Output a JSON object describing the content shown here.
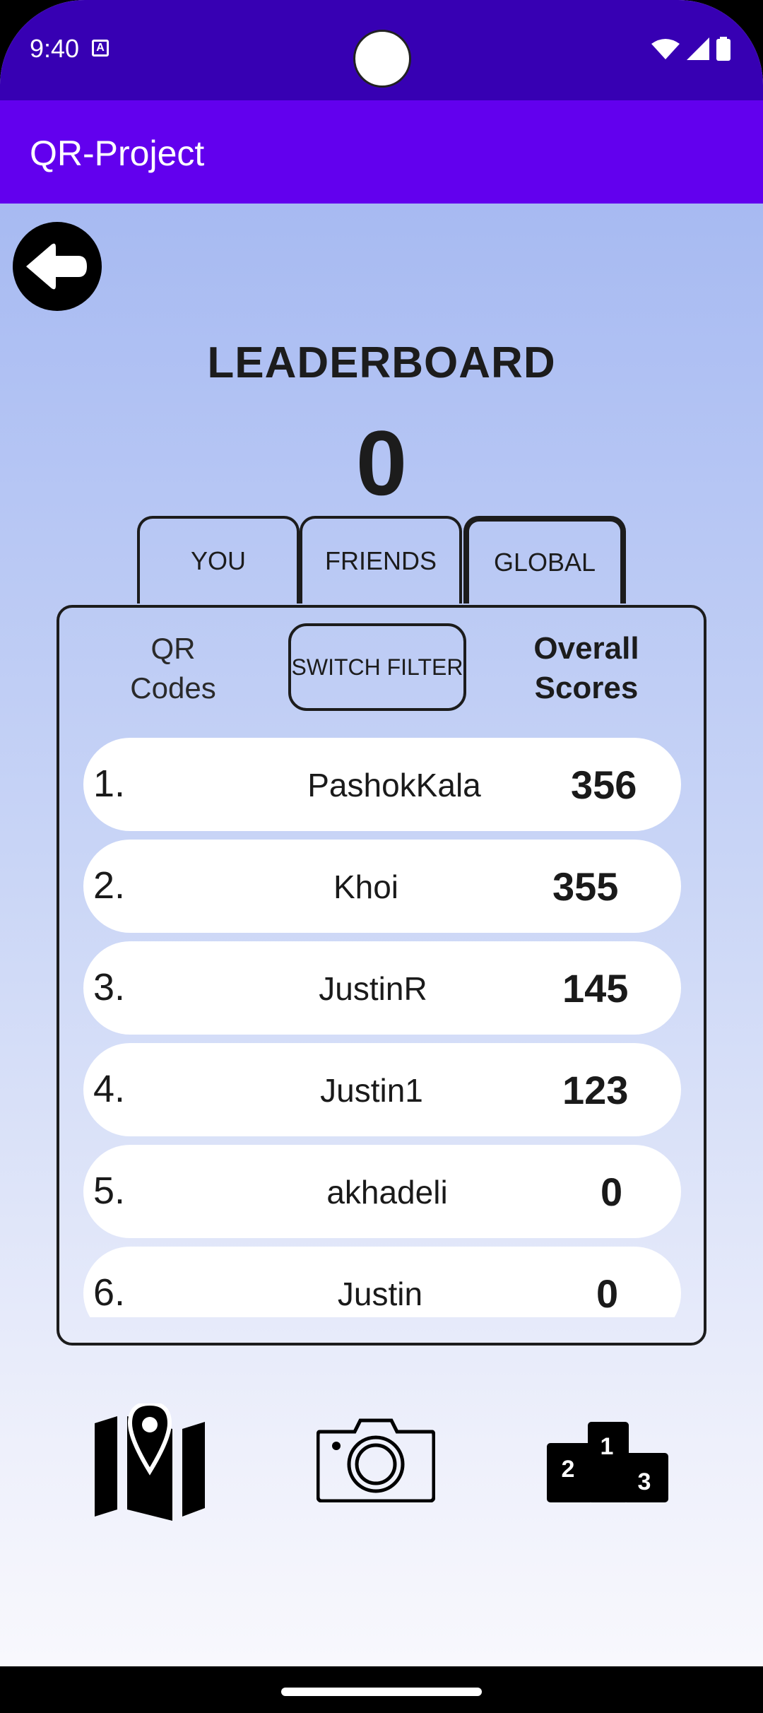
{
  "status_bar": {
    "time": "9:40",
    "notif_icon": "a-icon"
  },
  "app_bar": {
    "title": "QR-Project"
  },
  "leaderboard": {
    "title": "LEADERBOARD",
    "score": "0",
    "tabs": [
      {
        "label": "YOU",
        "active": false
      },
      {
        "label": "FRIENDS",
        "active": false
      },
      {
        "label": "GLOBAL",
        "active": true
      }
    ],
    "filter": {
      "left_label_line1": "QR",
      "left_label_line2": "Codes",
      "switch_label": "SWITCH FILTER",
      "right_label_line1": "Overall",
      "right_label_line2": "Scores"
    },
    "rows": [
      {
        "rank": "1.",
        "name": "PashokKala",
        "score": "356"
      },
      {
        "rank": "2.",
        "name": "Khoi",
        "score": "355"
      },
      {
        "rank": "3.",
        "name": "JustinR",
        "score": "145"
      },
      {
        "rank": "4.",
        "name": "Justin1",
        "score": "123"
      },
      {
        "rank": "5.",
        "name": "akhadeli",
        "score": "0"
      },
      {
        "rank": "6.",
        "name": "Justin",
        "score": "0"
      }
    ]
  },
  "bottom_nav": [
    {
      "icon": "map-icon"
    },
    {
      "icon": "camera-icon"
    },
    {
      "icon": "podium-icon",
      "labels": [
        "1",
        "2",
        "3"
      ]
    }
  ]
}
